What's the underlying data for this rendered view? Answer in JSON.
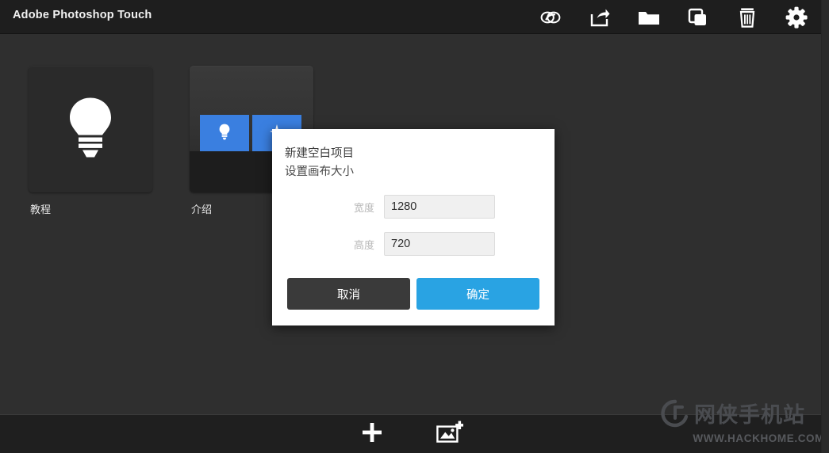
{
  "header": {
    "app_title": "Adobe Photoshop Touch",
    "toolbar": [
      {
        "name": "creative-cloud-icon",
        "label": "Creative Cloud"
      },
      {
        "name": "share-export-icon",
        "label": "Share"
      },
      {
        "name": "folder-icon",
        "label": "Open"
      },
      {
        "name": "duplicate-icon",
        "label": "Duplicate"
      },
      {
        "name": "trash-icon",
        "label": "Delete"
      },
      {
        "name": "gear-icon",
        "label": "Settings"
      }
    ]
  },
  "projects": [
    {
      "label": "教程",
      "thumb_icon": "lightbulb-icon"
    },
    {
      "label": "介绍",
      "thumb_icon": "tiles-icon"
    }
  ],
  "bottom_bar": {
    "actions": [
      {
        "name": "new-project-button",
        "icon": "plus-icon"
      },
      {
        "name": "add-image-button",
        "icon": "image-plus-icon"
      }
    ]
  },
  "dialog": {
    "title": "新建空白项目",
    "subtitle": "设置画布大小",
    "fields": [
      {
        "label": "宽度",
        "value": "1280",
        "placeholder": "1280"
      },
      {
        "label": "高度",
        "value": "720",
        "placeholder": "720"
      }
    ],
    "cancel_label": "取消",
    "confirm_label": "确定"
  },
  "watermark": {
    "site_name": "网侠手机站",
    "url": "WWW.HACKHOME.COM"
  },
  "colors": {
    "header_bg": "#1e1e1e",
    "canvas_bg": "#2f2f2f",
    "accent_blue": "#29a3e3",
    "tile_blue": "#3a7fe0",
    "cancel_dark": "#3a3a3a"
  }
}
